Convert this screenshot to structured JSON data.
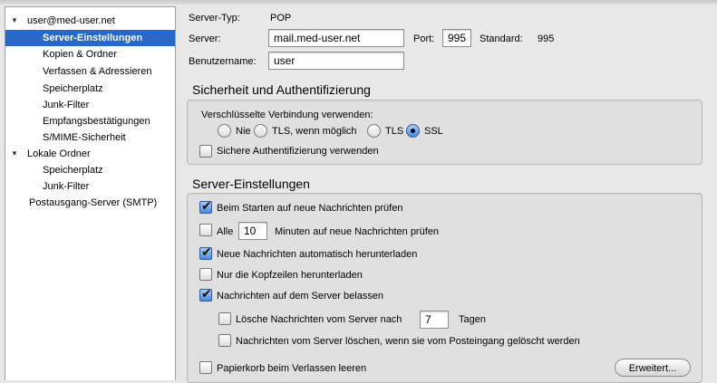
{
  "tree": {
    "account": "user@med-user.net",
    "items": [
      "Server-Einstellungen",
      "Kopien & Ordner",
      "Verfassen & Adressieren",
      "Speicherplatz",
      "Junk-Filter",
      "Empfangsbestätigungen",
      "S/MIME-Sicherheit"
    ],
    "local_folders": "Lokale Ordner",
    "local_items": [
      "Speicherplatz",
      "Junk-Filter"
    ],
    "smtp": "Postausgang-Server (SMTP)"
  },
  "server": {
    "type_label": "Server-Typ:",
    "type_value": "POP",
    "server_label": "Server:",
    "server_value": "mail.med-user.net",
    "port_label": "Port:",
    "port_value": "995",
    "standard_label": "Standard:",
    "standard_value": "995",
    "username_label": "Benutzername:",
    "username_value": "user"
  },
  "security": {
    "title": "Sicherheit und Authentifizierung",
    "encrypted_label": "Verschlüsselte Verbindung verwenden:",
    "options": [
      "Nie",
      "TLS, wenn möglich",
      "TLS",
      "SSL"
    ],
    "selected": "SSL",
    "secure_auth": "Sichere Authentifizierung verwenden",
    "secure_auth_checked": false
  },
  "settings": {
    "title": "Server-Einstellungen",
    "check_on_start": "Beim Starten auf neue Nachrichten prüfen",
    "check_on_start_checked": true,
    "check_every_prefix": "Alle",
    "check_every_value": "10",
    "check_every_suffix": "Minuten auf neue Nachrichten prüfen",
    "check_every_checked": false,
    "auto_download": "Neue Nachrichten automatisch herunterladen",
    "auto_download_checked": true,
    "headers_only": "Nur die Kopfzeilen herunterladen",
    "headers_only_checked": false,
    "leave_on_server": "Nachrichten auf dem Server belassen",
    "leave_on_server_checked": true,
    "delete_after_prefix": "Lösche Nachrichten vom Server nach",
    "delete_after_value": "7",
    "delete_after_suffix": "Tagen",
    "delete_after_checked": false,
    "delete_when_deleted": "Nachrichten vom Server löschen, wenn sie vom Posteingang gelöscht werden",
    "delete_when_deleted_checked": false,
    "empty_trash": "Papierkorb beim Verlassen leeren",
    "empty_trash_checked": false,
    "advanced_button": "Erweitert..."
  }
}
